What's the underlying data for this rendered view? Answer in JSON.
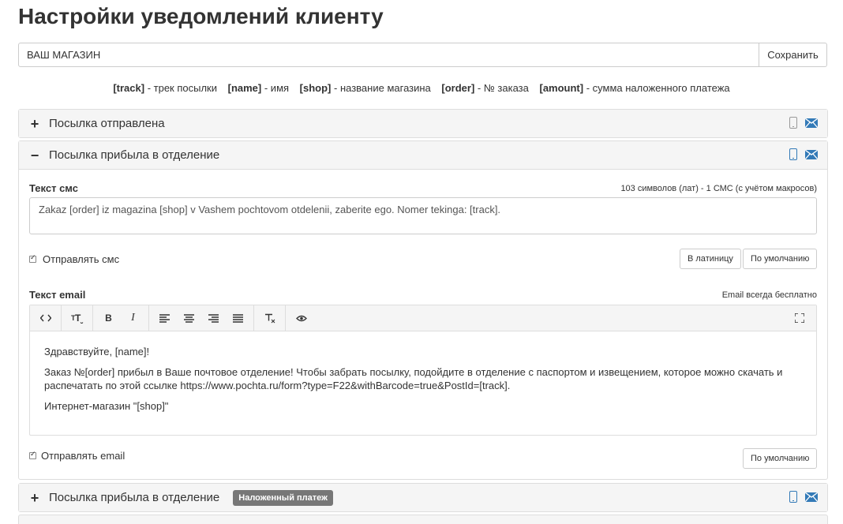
{
  "page": {
    "title": "Настройки уведомлений клиенту"
  },
  "shop": {
    "value": "ВАШ МАГАЗИН",
    "save_label": "Сохранить"
  },
  "macros": [
    {
      "key": "[track]",
      "desc": " - трек посылки"
    },
    {
      "key": "[name]",
      "desc": " - имя"
    },
    {
      "key": "[shop]",
      "desc": " - название магазина"
    },
    {
      "key": "[order]",
      "desc": " - № заказа"
    },
    {
      "key": "[amount]",
      "desc": " - сумма наложенного платежа"
    }
  ],
  "panels": [
    {
      "toggle": "+",
      "title": "Посылка отправлена"
    },
    {
      "toggle": "−",
      "title": "Посылка прибыла в отделение",
      "sms_label": "Текст смс",
      "sms_counter": "103 символов (лат) - 1 СМС (с учётом макросов)",
      "sms_text": "Zakaz [order] iz magazina [shop] v Vashem pochtovom otdelenii, zaberite ego. Nomer tekinga: [track].",
      "send_sms_label": "Отправлять смс",
      "translit_label": "В латиницу",
      "default_label": "По умолчанию",
      "email_label": "Текст email",
      "email_hint": "Email всегда бесплатно",
      "email_p1": "Здравствуйте, [name]!",
      "email_p2": "Заказ №[order] прибыл в Ваше почтовое отделение! Чтобы забрать посылку, подойдите в отделение с паспортом и извещением, которое можно скачать и распечатать по этой ссылке https://www.pochta.ru/form?type=F22&withBarcode=true&PostId=[track].",
      "email_p3": "Интернет-магазин \"[shop]\"",
      "send_email_label": "Отправлять email",
      "email_default_label": "По умолчанию"
    },
    {
      "toggle": "+",
      "title": "Посылка прибыла в отделение",
      "badge": "Наложенный платеж"
    }
  ],
  "toolbar": {
    "code": "<>",
    "bold": "B",
    "italic": "I"
  },
  "colors": {
    "accent": "#337ab7",
    "panel_head": "#f5f5f5",
    "badge": "#777777"
  }
}
